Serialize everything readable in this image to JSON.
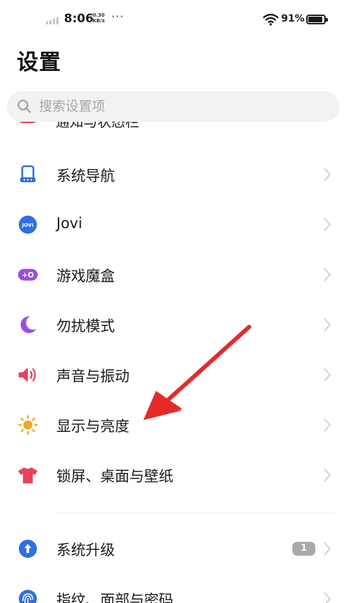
{
  "status_bar": {
    "time": "8:06",
    "net_speed_value": "0.30",
    "net_speed_unit": "KB/s",
    "more": "···",
    "battery_percent": "91%",
    "battery_level": 0.91
  },
  "header": {
    "title": "设置"
  },
  "search": {
    "placeholder": "搜索设置项"
  },
  "settings": {
    "partial_item_label": "通知与状态栏",
    "items": [
      {
        "label": "系统导航",
        "icon": "navigation-icon",
        "color": "#2f6fe0"
      },
      {
        "label": "Jovi",
        "icon": "jovi-icon",
        "color": "#2f6fe0",
        "icon_text": "JOVI"
      },
      {
        "label": "游戏魔盒",
        "icon": "game-box-icon",
        "color": "#9a4fe0",
        "icon_text": "+O"
      },
      {
        "label": "勿扰模式",
        "icon": "moon-icon",
        "color": "#9a4fe0"
      },
      {
        "label": "声音与振动",
        "icon": "speaker-icon",
        "color": "#e8435a"
      },
      {
        "label": "显示与亮度",
        "icon": "sun-icon",
        "color": "#f5a623"
      },
      {
        "label": "锁屏、桌面与壁纸",
        "icon": "tshirt-icon",
        "color": "#e8435a"
      },
      {
        "label": "系统升级",
        "icon": "upgrade-icon",
        "color": "#2f6fe0",
        "badge": "1"
      },
      {
        "label": "指纹、面部与密码",
        "icon": "fingerprint-icon",
        "color": "#2f6fe0"
      }
    ]
  },
  "annotation": {
    "color": "#e52a2a"
  }
}
